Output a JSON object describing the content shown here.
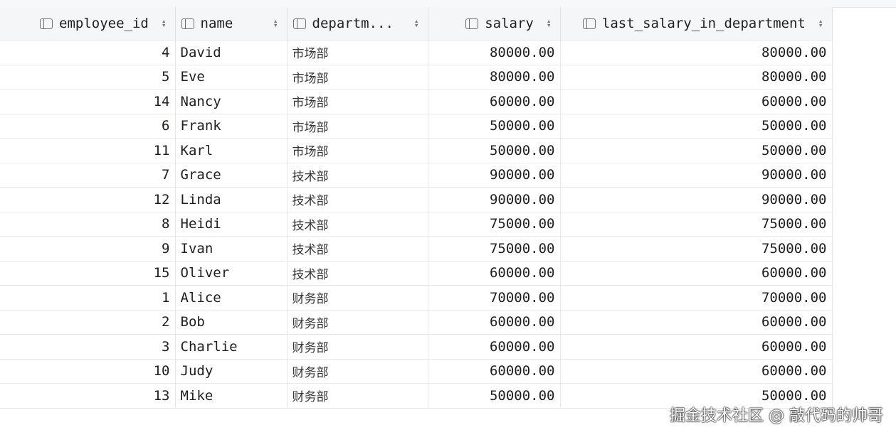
{
  "columns": [
    {
      "label": "employee_id"
    },
    {
      "label": "name"
    },
    {
      "label": "departm..."
    },
    {
      "label": "salary"
    },
    {
      "label": "last_salary_in_department"
    }
  ],
  "rows": [
    {
      "employee_id": "4",
      "name": "David",
      "department": "市场部",
      "salary": "80000.00",
      "last_salary": "80000.00"
    },
    {
      "employee_id": "5",
      "name": "Eve",
      "department": "市场部",
      "salary": "80000.00",
      "last_salary": "80000.00"
    },
    {
      "employee_id": "14",
      "name": "Nancy",
      "department": "市场部",
      "salary": "60000.00",
      "last_salary": "60000.00"
    },
    {
      "employee_id": "6",
      "name": "Frank",
      "department": "市场部",
      "salary": "50000.00",
      "last_salary": "50000.00"
    },
    {
      "employee_id": "11",
      "name": "Karl",
      "department": "市场部",
      "salary": "50000.00",
      "last_salary": "50000.00"
    },
    {
      "employee_id": "7",
      "name": "Grace",
      "department": "技术部",
      "salary": "90000.00",
      "last_salary": "90000.00"
    },
    {
      "employee_id": "12",
      "name": "Linda",
      "department": "技术部",
      "salary": "90000.00",
      "last_salary": "90000.00"
    },
    {
      "employee_id": "8",
      "name": "Heidi",
      "department": "技术部",
      "salary": "75000.00",
      "last_salary": "75000.00"
    },
    {
      "employee_id": "9",
      "name": "Ivan",
      "department": "技术部",
      "salary": "75000.00",
      "last_salary": "75000.00"
    },
    {
      "employee_id": "15",
      "name": "Oliver",
      "department": "技术部",
      "salary": "60000.00",
      "last_salary": "60000.00"
    },
    {
      "employee_id": "1",
      "name": "Alice",
      "department": "财务部",
      "salary": "70000.00",
      "last_salary": "70000.00"
    },
    {
      "employee_id": "2",
      "name": "Bob",
      "department": "财务部",
      "salary": "60000.00",
      "last_salary": "60000.00"
    },
    {
      "employee_id": "3",
      "name": "Charlie",
      "department": "财务部",
      "salary": "60000.00",
      "last_salary": "60000.00"
    },
    {
      "employee_id": "10",
      "name": "Judy",
      "department": "财务部",
      "salary": "60000.00",
      "last_salary": "60000.00"
    },
    {
      "employee_id": "13",
      "name": "Mike",
      "department": "财务部",
      "salary": "50000.00",
      "last_salary": "50000.00"
    }
  ],
  "watermark": "掘金技术社区 @ 敲代码的帅哥",
  "icons": {
    "column": "column-icon",
    "sort": "sort-icon"
  }
}
